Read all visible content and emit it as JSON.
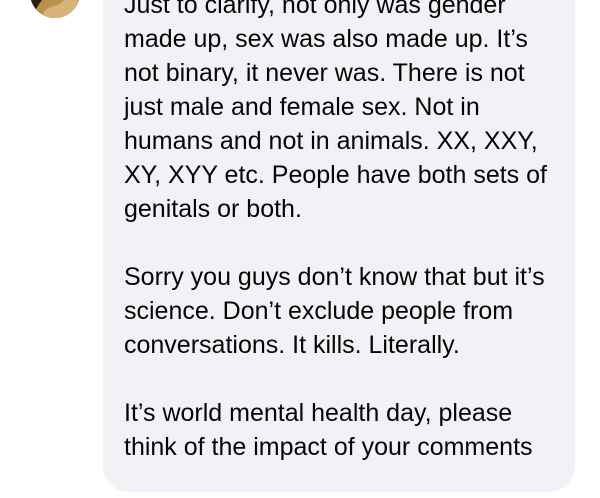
{
  "comment": {
    "paragraphs": [
      "Just to clarify, not only was gender made up, sex was also made up. It’s not binary, it never was. There is not just male and female sex. Not in humans and not in animals. XX, XXY, XY, XYY etc. People have both sets of genitals or both.",
      "Sorry you guys don’t know that but it’s science. Don’t exclude people from conversations. It kills. Literally.",
      "It’s world mental health day, please think of the impact of your comments"
    ]
  },
  "colors": {
    "bubble_background": "#f0f2f5",
    "text": "#050505",
    "page_background": "#ffffff"
  }
}
